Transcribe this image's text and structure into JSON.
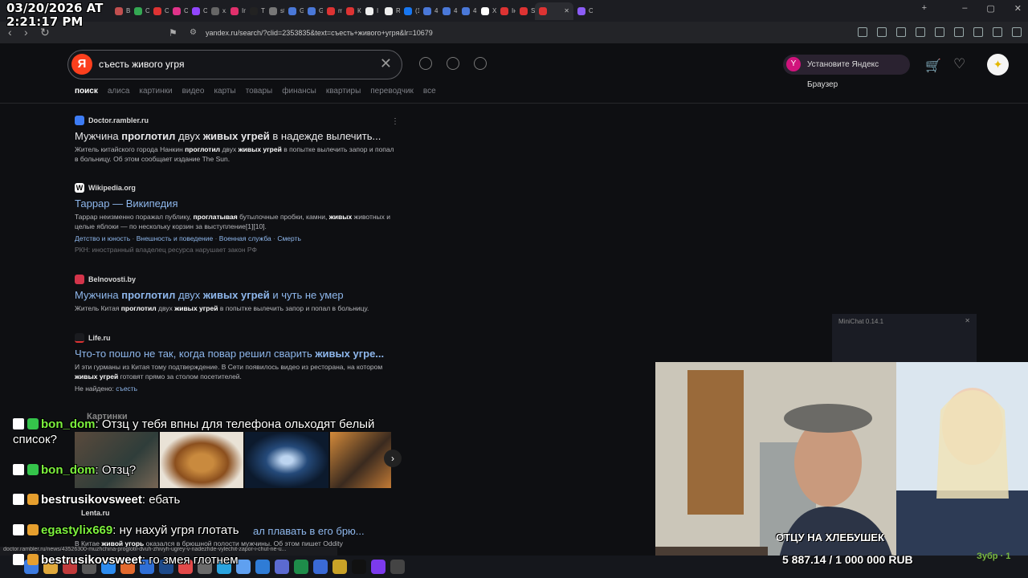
{
  "clock": {
    "date": "03/20/2026 AT",
    "time": "2:21:17 PM"
  },
  "browser": {
    "tabs": [
      {
        "label": "Вх",
        "color": "#c14f4f"
      },
      {
        "label": "ОТ",
        "color": "#34a853"
      },
      {
        "label": "ОТ",
        "color": "#d33"
      },
      {
        "label": "Ст",
        "color": "#e0338a"
      },
      {
        "label": "ОТ",
        "color": "#9146ff"
      },
      {
        "label": "x.c",
        "color": "#666"
      },
      {
        "label": "Ins",
        "color": "#e1306c"
      },
      {
        "label": "Tik",
        "color": "#222"
      },
      {
        "label": "stu",
        "color": "#777"
      },
      {
        "label": "Go",
        "color": "#4a78d8"
      },
      {
        "label": "Go",
        "color": "#4a78d8"
      },
      {
        "label": "mo",
        "color": "#d33"
      },
      {
        "label": "Ка",
        "color": "#d33"
      },
      {
        "label": "І Н",
        "color": "#eee"
      },
      {
        "label": "Re",
        "color": "#eee"
      },
      {
        "label": "(1)",
        "color": "#1877f2"
      },
      {
        "label": "4PI",
        "color": "#4a78d8"
      },
      {
        "label": "4PI",
        "color": "#4a78d8"
      },
      {
        "label": "4PI",
        "color": "#4a78d8"
      },
      {
        "label": "Ха",
        "color": "#fff"
      },
      {
        "label": "Ін",
        "color": "#d33"
      },
      {
        "label": "Su",
        "color": "#d33"
      },
      {
        "label": "",
        "color": "#d33",
        "active": true
      },
      {
        "label": "Oc",
        "color": "#8b5cf6"
      }
    ],
    "url": "yandex.ru/search/?clid=2353835&text=съесть+живого+угря&lr=10679"
  },
  "search": {
    "query": "съесть живого угря",
    "logo": "Я"
  },
  "promo": {
    "label": "Установите Яндекс Браузер"
  },
  "nav_tabs": [
    "поиск",
    "алиса",
    "картинки",
    "видео",
    "карты",
    "товары",
    "финансы",
    "квартиры",
    "переводчик",
    "все"
  ],
  "results": [
    {
      "source": "Doctor.rambler.ru",
      "icon_color": "#3d7cf5",
      "title_parts": [
        "Мужчина ",
        "проглотил",
        " двух ",
        "живых угрей",
        " в надежде вылечить..."
      ],
      "snippet_html_parts": [
        "Житель китайского города Нанкин ",
        "проглотил",
        " двух ",
        "живых угрей",
        " в попытке вылечить запор и попал в больницу. Об этом сообщает издание The Sun."
      ]
    },
    {
      "source": "Wikipedia.org",
      "icon_color": "#fff",
      "title": "Таррар — Википедия",
      "snippet_parts": [
        "Таррар неизменно поражал публику, ",
        "проглатывая",
        " бутылочные пробки, камни, ",
        "живых",
        " животных и целые яблоки — по нескольку корзин за выступление[1][10]."
      ],
      "sitelinks": [
        "Детство и юность",
        "Внешность и поведение",
        "Военная служба",
        "Смерть"
      ],
      "note": "РКН: иностранный владелец ресурса нарушает закон РФ"
    },
    {
      "source": "Belnovosti.by",
      "icon_color": "#d3344a",
      "title_parts": [
        "Мужчина ",
        "проглотил",
        " двух ",
        "живых угрей",
        " и чуть не умер"
      ],
      "snippet_parts": [
        "Житель Китая ",
        "проглотил",
        " двух ",
        "живых угрей",
        " в попытке вылечить запор и попал в больницу."
      ]
    },
    {
      "source": "Life.ru",
      "icon_color": "#d33",
      "title_parts": [
        "Что-то пошло не так, когда повар решил сварить ",
        "живых угре..."
      ],
      "snippet_parts": [
        "И эти гурманы из Китая тому подтверждение. В Сети появилось видео из ресторана, на котором ",
        "живых угрей",
        " готовят прямо за столом посетителей."
      ],
      "notfound_label": "Не найдено:",
      "notfound_word": "съесть"
    }
  ],
  "images_heading": "Картинки",
  "lenta": {
    "source": "Lenta.ru",
    "title_tail": "ал плавать в его брю...",
    "snippet_parts": [
      "В Китае ",
      "живой угорь",
      " оказался в брюшной полости мужчины. Об этом пишет Oddity"
    ]
  },
  "status_url": "doctor.rambler.ru/news/43526300-muzhchina-proglotil-dvuh-zhivyh-ugrey-v-nadezhde-vylechit-zapor-i-chut-ne-u...",
  "chat": [
    {
      "user": "bon_dom",
      "user_color": "#7cf03d",
      "message": "Отзц у тебя впны для телефона ольходят белый",
      "message2": "список?",
      "icon_color": "#35c44b"
    },
    {
      "user": "bon_dom",
      "user_color": "#7cf03d",
      "message": "Отзц?",
      "icon_color": "#35c44b"
    },
    {
      "user": "bestrusikovsweet",
      "user_color": "#ffffff",
      "message": "ебать",
      "icon_color": "#e69f2e"
    },
    {
      "user": "egastylix669",
      "user_color": "#7cf03d",
      "message": "ну нахуй угря глотать",
      "icon_color": "#e69f2e"
    },
    {
      "user": "bestrusikovsweet",
      "user_color": "#ffffff",
      "message": "го змея глотнем",
      "icon_color": "#e69f2e"
    }
  ],
  "minichat": {
    "title": "MiniChat 0.14.1"
  },
  "stream_overlay": {
    "caption": "ОТЦУ НА ХЛЕБУШЕК",
    "donation": "5 887.14 / 1 000 000 RUB",
    "brand": "Зубр · 1"
  }
}
